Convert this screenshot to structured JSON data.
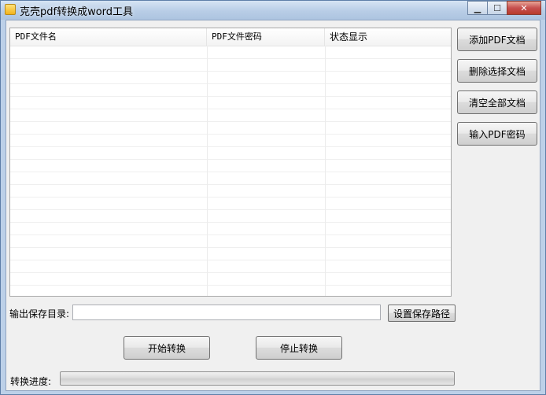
{
  "window": {
    "title": "克壳pdf转换成word工具"
  },
  "titlebar_buttons": {
    "minimize": "▁",
    "maximize": "☐",
    "close": "✕"
  },
  "list": {
    "columns": [
      "PDF文件名",
      "PDF文件密码",
      "状态显示"
    ]
  },
  "side_buttons": {
    "add": "添加PDF文档",
    "delete": "删除选择文档",
    "clear": "清空全部文档",
    "password": "输入PDF密码"
  },
  "output": {
    "label": "输出保存目录:",
    "value": "",
    "browse_button": "设置保存路径"
  },
  "actions": {
    "start": "开始转换",
    "stop": "停止转换"
  },
  "progress": {
    "label": "转换进度:",
    "value": 0
  },
  "colors": {
    "titlebar": "#b8cde6",
    "client": "#f0f0f0",
    "progress_fill": "#37b518"
  }
}
